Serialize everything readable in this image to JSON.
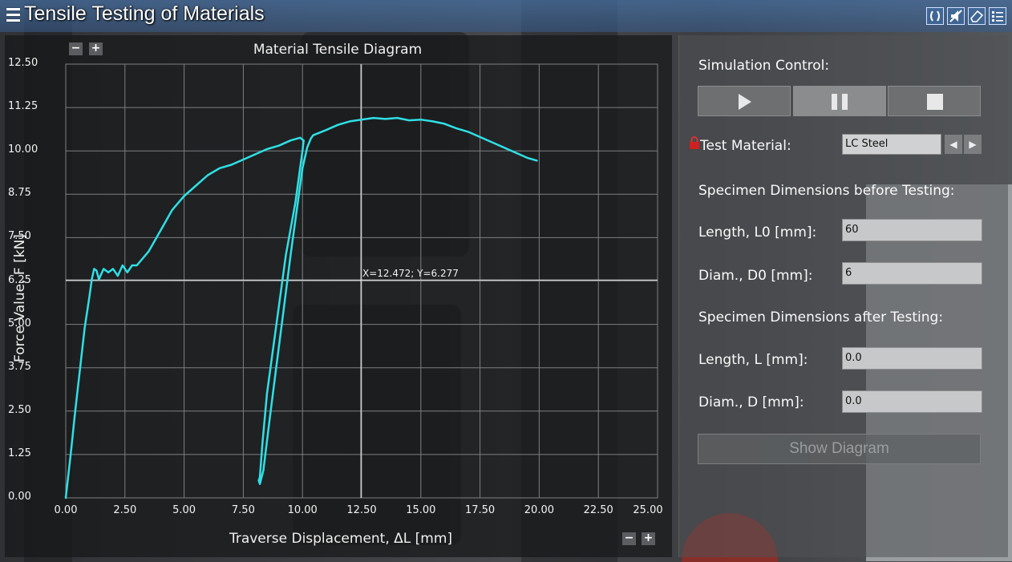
{
  "window": {
    "title": "Tensile Testing of Materials",
    "icons": [
      "fullscreen-icon",
      "mute-icon",
      "eraser-icon",
      "list-icon"
    ]
  },
  "chart_data": {
    "type": "line",
    "title": "Material Tensile Diagram",
    "xlabel": "Traverse Displacement, ΔL [mm]",
    "ylabel": "Force Value, F [kN]",
    "xlim": [
      0,
      25
    ],
    "ylim": [
      0,
      12.5
    ],
    "x_ticks": [
      "0.00",
      "2.50",
      "5.00",
      "7.50",
      "10.00",
      "12.50",
      "15.00",
      "17.50",
      "20.00",
      "22.50",
      "25.00"
    ],
    "y_ticks": [
      "0.00",
      "1.25",
      "2.50",
      "3.75",
      "5.00",
      "6.25",
      "7.50",
      "8.75",
      "10.00",
      "11.25",
      "12.50"
    ],
    "grid": true,
    "color": "#2fe0e6",
    "cursor": {
      "x": 12.472,
      "y": 6.277,
      "label": "X=12.472; Y=6.277"
    },
    "series": [
      {
        "x": [
          0.0,
          0.2,
          0.4,
          0.6,
          0.8,
          1.0,
          1.1,
          1.2,
          1.3,
          1.4,
          1.5,
          1.6,
          1.8,
          2.0,
          2.2,
          2.4,
          2.6,
          2.8,
          3.0,
          3.5,
          4.0,
          4.5,
          5.0,
          5.5,
          6.0,
          6.5,
          7.0,
          7.5,
          8.0,
          8.5,
          9.0,
          9.5,
          9.9,
          10.05,
          10.0,
          9.7,
          9.3,
          8.9,
          8.5,
          8.3,
          8.2,
          8.15,
          8.2,
          8.35,
          8.6,
          8.9,
          9.2,
          9.5,
          9.8,
          10.0,
          10.2,
          10.35,
          10.45,
          11.0,
          11.5,
          12.0,
          12.5,
          13.0,
          13.5,
          14.0,
          14.5,
          15.0,
          15.5,
          16.0,
          16.5,
          17.0,
          17.5,
          18.0,
          18.5,
          19.0,
          19.5,
          19.9
        ],
        "y": [
          0.0,
          1.2,
          2.5,
          3.7,
          4.9,
          5.8,
          6.3,
          6.6,
          6.55,
          6.3,
          6.45,
          6.6,
          6.5,
          6.6,
          6.4,
          6.7,
          6.5,
          6.7,
          6.7,
          7.1,
          7.7,
          8.3,
          8.7,
          9.0,
          9.3,
          9.5,
          9.6,
          9.75,
          9.9,
          10.05,
          10.15,
          10.3,
          10.38,
          10.3,
          10.0,
          8.5,
          7.0,
          5.0,
          3.0,
          1.5,
          0.6,
          0.5,
          0.4,
          0.8,
          2.2,
          3.8,
          5.4,
          7.0,
          8.5,
          9.5,
          10.1,
          10.35,
          10.45,
          10.6,
          10.75,
          10.85,
          10.9,
          10.95,
          10.92,
          10.95,
          10.88,
          10.9,
          10.85,
          10.78,
          10.65,
          10.55,
          10.4,
          10.25,
          10.1,
          9.95,
          9.8,
          9.72
        ]
      }
    ]
  },
  "controls": {
    "simulation_control_label": "Simulation Control:",
    "play_icon": "play-icon",
    "pause_icon": "pause-icon",
    "stop_icon": "stop-icon",
    "test_material_label": "Test Material:",
    "test_material_value": "LC Steel",
    "before_heading": "Specimen Dimensions before Testing:",
    "length_before_label": "Length, L0 [mm]:",
    "length_before_value": "60",
    "diam_before_label": "Diam., D0 [mm]:",
    "diam_before_value": "6",
    "after_heading": "Specimen Dimensions after Testing:",
    "length_after_label": "Length, L [mm]:",
    "length_after_value": "0.0",
    "diam_after_label": "Diam., D [mm]:",
    "diam_after_value": "0.0",
    "show_diagram_label": "Show Diagram"
  }
}
